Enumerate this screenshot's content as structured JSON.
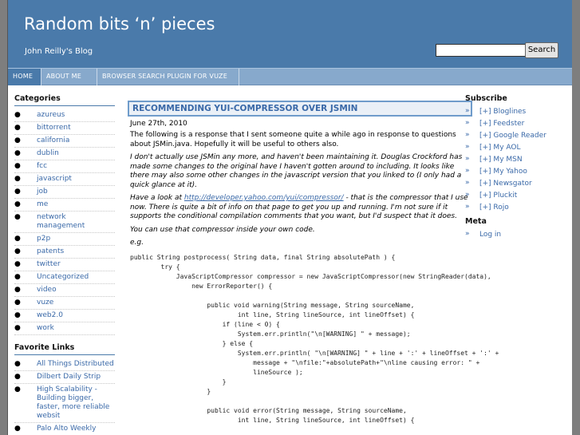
{
  "header": {
    "site_title": "Random bits ‘n’ pieces",
    "tagline": "John Reilly's Blog",
    "search_placeholder": "",
    "search_button": "Search",
    "bg_color": "#4a7aaa"
  },
  "nav": [
    {
      "label": "HOME"
    },
    {
      "label": "ABOUT ME"
    },
    {
      "label": "BROWSER SEARCH PLUGIN FOR VUZE"
    }
  ],
  "categories": {
    "heading": "Categories",
    "items": [
      "azureus",
      "bittorrent",
      "california",
      "dublin",
      "fcc",
      "javascript",
      "job",
      "me",
      "network management",
      "p2p",
      "patents",
      "twitter",
      "Uncategorized",
      "video",
      "vuze",
      "web2.0",
      "work"
    ]
  },
  "favorite_links": {
    "heading": "Favorite Links",
    "items": [
      "All Things Distributed",
      "Dilbert Daily Strip",
      "High Scalability - Building bigger, faster, more reliable websit",
      "Palo Alto Weekly"
    ]
  },
  "post": {
    "title": "RECOMMENDING YUI-COMPRESSOR OVER JSMIN",
    "date": "June 27th, 2010",
    "p1": "The following is a response that I sent someone quite a while ago in response to questions about JSMin.java.  Hopefully it will be useful to others also.",
    "p2": "I don't actually use JSMin any more, and haven't been maintaining it.  Douglas Crockford has made some changes to the original have I haven't gotten around to including.  It looks like there may also some other changes in the javascript version that you linked to (I only had a quick glance at it).",
    "p3_prefix": "Have a look at ",
    "p3_link": "http://developer.yahoo.com/yui/compressor/",
    "p3_suffix": " - that is the compressor that I use now.  There is quite a bit of info on that page to get you up and running.  I'm not sure if it supports the conditional compilation comments that you want, but I'd suspect that it does.",
    "p4": "You can use that compressor inside your own code.",
    "p5": "e.g.",
    "code": "public String postprocess( String data, final String absolutePath ) {\n        try {\n            JavaScriptCompressor compressor = new JavaScriptCompressor(new StringReader(data),\n                new ErrorReporter() {\n\n                    public void warning(String message, String sourceName,\n                            int line, String lineSource, int lineOffset) {\n                        if (line < 0) {\n                            System.err.println(\"\\n[WARNING] \" + message);\n                        } else {\n                            System.err.println( \"\\n[WARNING] \" + line + ':' + lineOffset + ':' +\n                                message + \"\\nfile:\"+absolutePath+\"\\nline causing error: \" +\n                                lineSource );\n                        }\n                    }\n\n                    public void error(String message, String sourceName,\n                            int line, String lineSource, int lineOffset) {"
  },
  "subscribe": {
    "heading": "Subscribe",
    "items": [
      "[+] Bloglines",
      "[+] Feedster",
      "[+] Google Reader",
      "[+] My AOL",
      "[+] My MSN",
      "[+] My Yahoo",
      "[+] Newsgator",
      "[+] Pluckit",
      "[+] Rojo"
    ]
  },
  "meta": {
    "heading": "Meta",
    "items": [
      "Log in"
    ]
  }
}
